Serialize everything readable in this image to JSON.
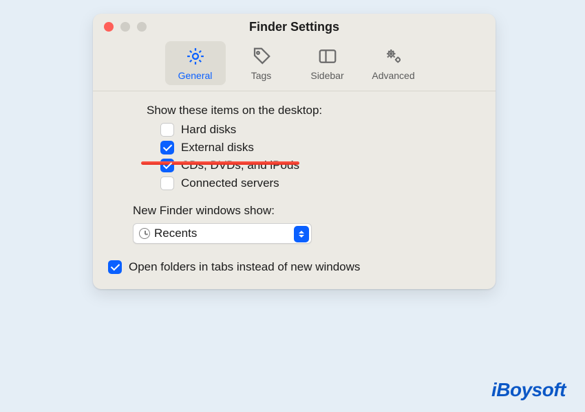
{
  "window": {
    "title": "Finder Settings"
  },
  "tabs": [
    {
      "label": "General",
      "icon": "gear-icon",
      "active": true
    },
    {
      "label": "Tags",
      "icon": "tag-icon",
      "active": false
    },
    {
      "label": "Sidebar",
      "icon": "sidebar-icon",
      "active": false
    },
    {
      "label": "Advanced",
      "icon": "gears-icon",
      "active": false
    }
  ],
  "desktop_section": {
    "heading": "Show these items on the desktop:",
    "items": [
      {
        "label": "Hard disks",
        "checked": false
      },
      {
        "label": "External disks",
        "checked": true,
        "annotated": true
      },
      {
        "label": "CDs, DVDs, and iPods",
        "checked": true
      },
      {
        "label": "Connected servers",
        "checked": false
      }
    ]
  },
  "new_windows_section": {
    "heading": "New Finder windows show:",
    "select": {
      "icon": "clock-icon",
      "value": "Recents"
    }
  },
  "open_in_tabs": {
    "label": "Open folders in tabs instead of new windows",
    "checked": true
  },
  "watermark": "iBoysoft",
  "colors": {
    "accent": "#0a60ff",
    "annotation": "#ff3b2f"
  }
}
